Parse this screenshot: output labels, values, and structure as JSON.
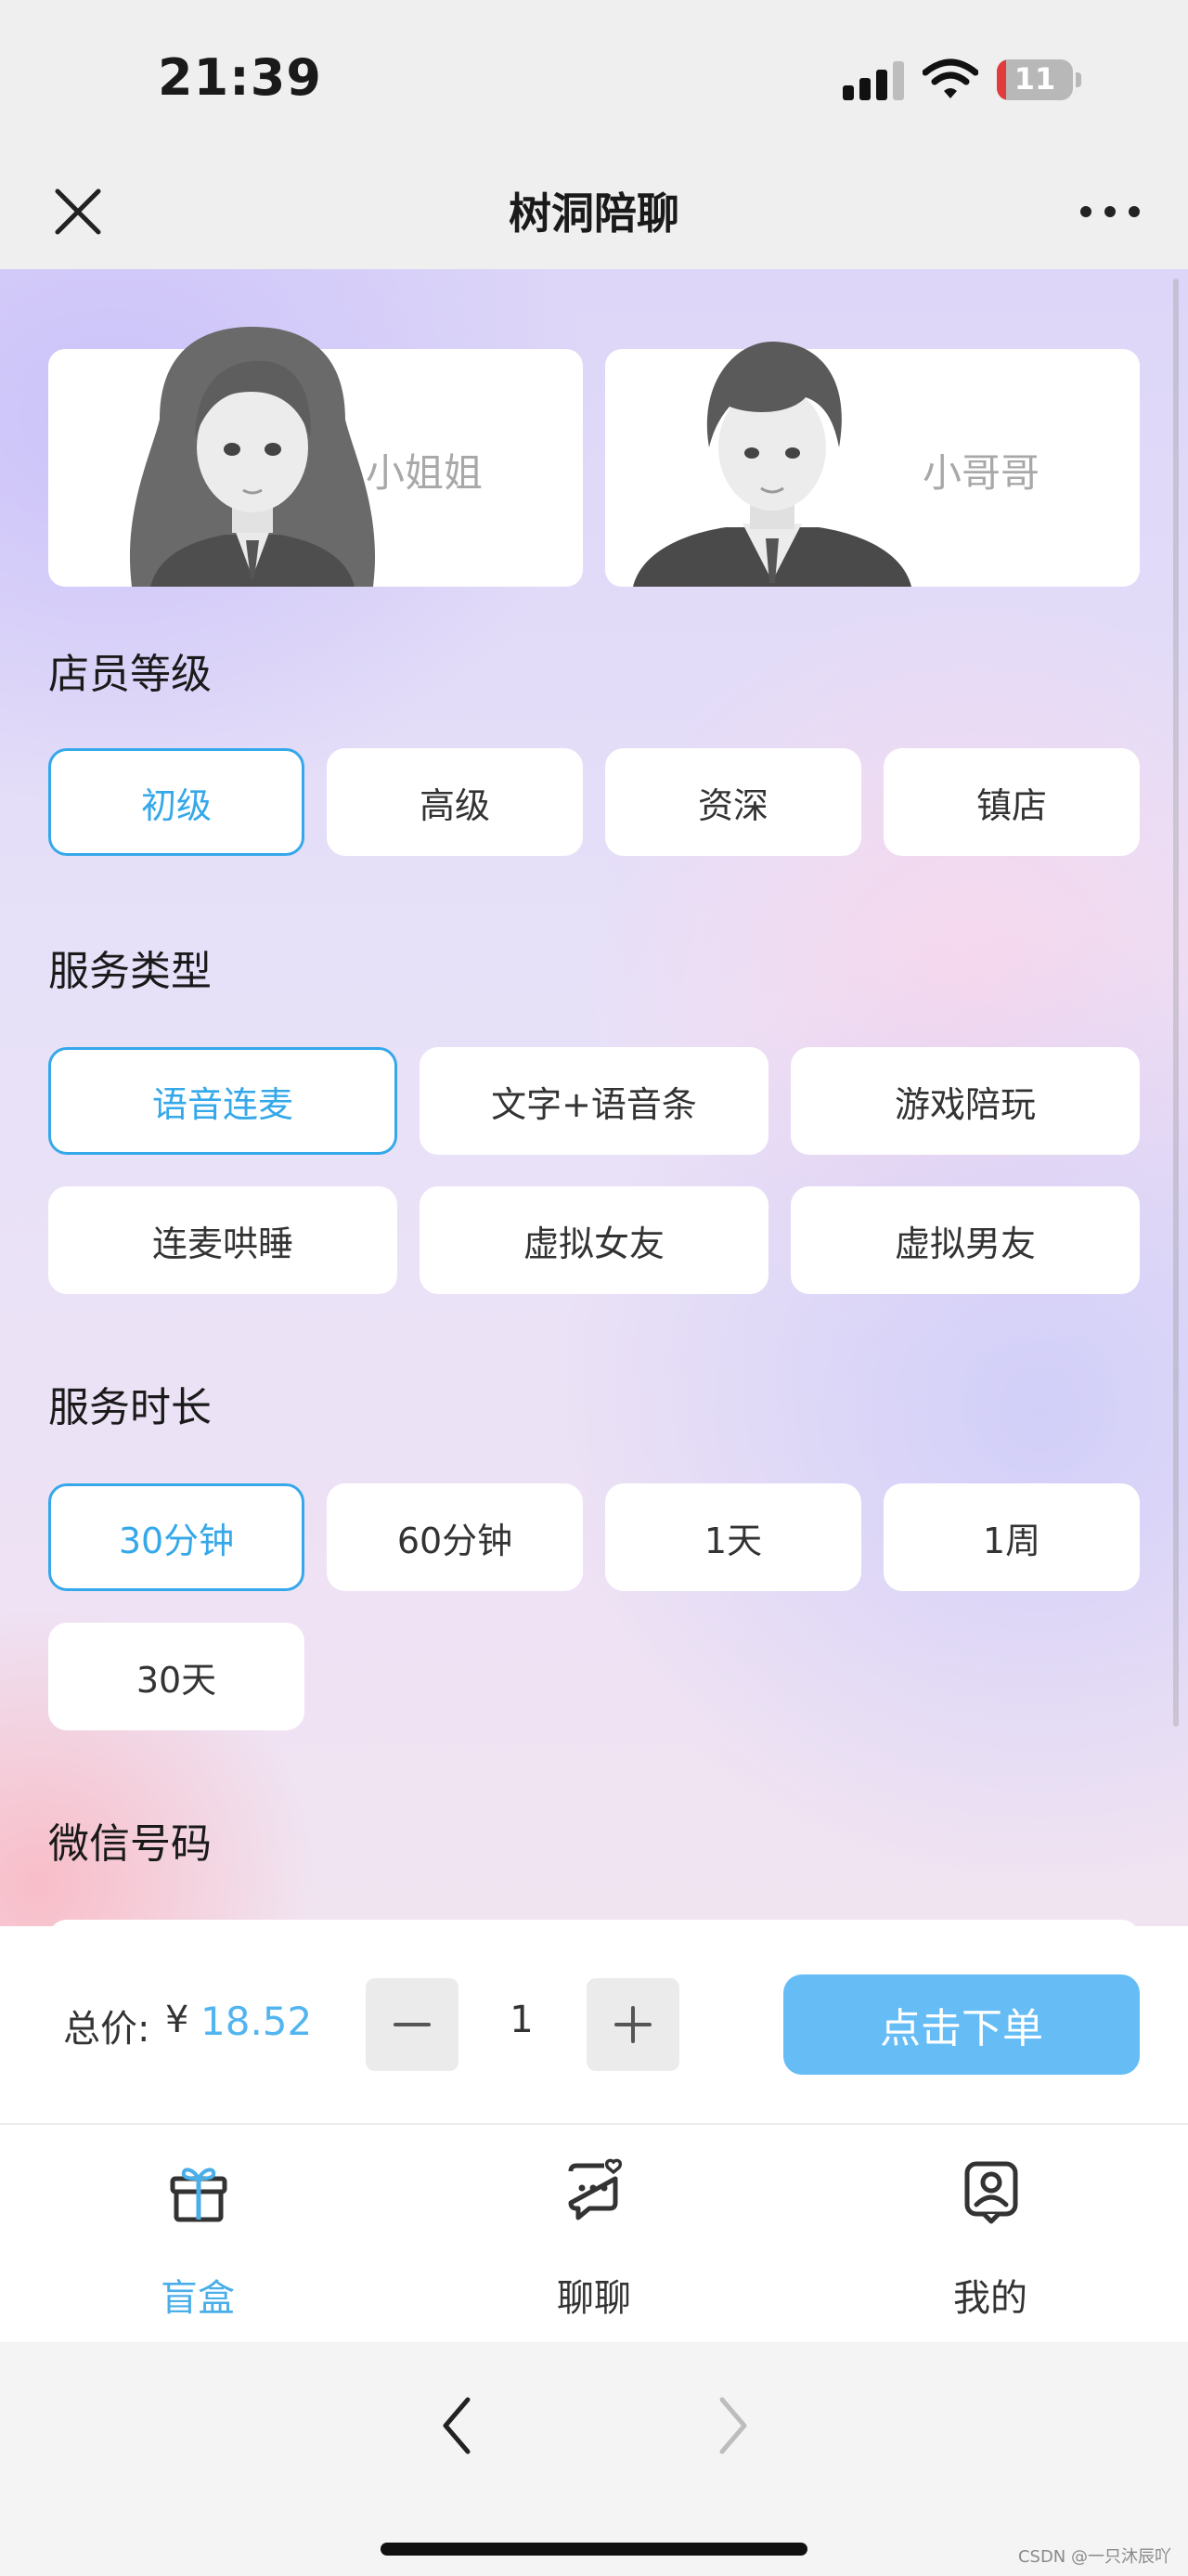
{
  "status_bar": {
    "time": "21:39",
    "battery": "11",
    "icons": [
      "signal-icon",
      "wifi-icon",
      "battery-icon"
    ]
  },
  "nav": {
    "title": "树洞陪聊",
    "icons": [
      "close-icon",
      "more-icon"
    ]
  },
  "gender": {
    "female": "小姐姐",
    "male": "小哥哥"
  },
  "level": {
    "title": "店员等级",
    "options": [
      "初级",
      "高级",
      "资深",
      "镇店"
    ],
    "selected": "初级"
  },
  "service_type": {
    "title": "服务类型",
    "options": [
      "语音连麦",
      "文字+语音条",
      "游戏陪玩",
      "连麦哄睡",
      "虚拟女友",
      "虚拟男友"
    ],
    "selected": "语音连麦"
  },
  "duration": {
    "title": "服务时长",
    "options": [
      "30分钟",
      "60分钟",
      "1天",
      "1周",
      "30天"
    ],
    "selected": "30分钟"
  },
  "wechat": {
    "title": "微信号码"
  },
  "order": {
    "total_label": "总价:",
    "currency": "¥",
    "price": "18.52",
    "quantity": "1",
    "submit_label": "点击下单"
  },
  "tabs": [
    {
      "label": "盲盒",
      "icon": "gift-box-icon",
      "active": true
    },
    {
      "label": "聊聊",
      "icon": "chat-bubble-icon",
      "active": false
    },
    {
      "label": "我的",
      "icon": "profile-icon",
      "active": false
    }
  ],
  "watermark": "CSDN @一只沐辰吖",
  "colors": {
    "accent": "#35a8ea",
    "order_button": "#66bdf6",
    "price": "#52b5f0"
  }
}
